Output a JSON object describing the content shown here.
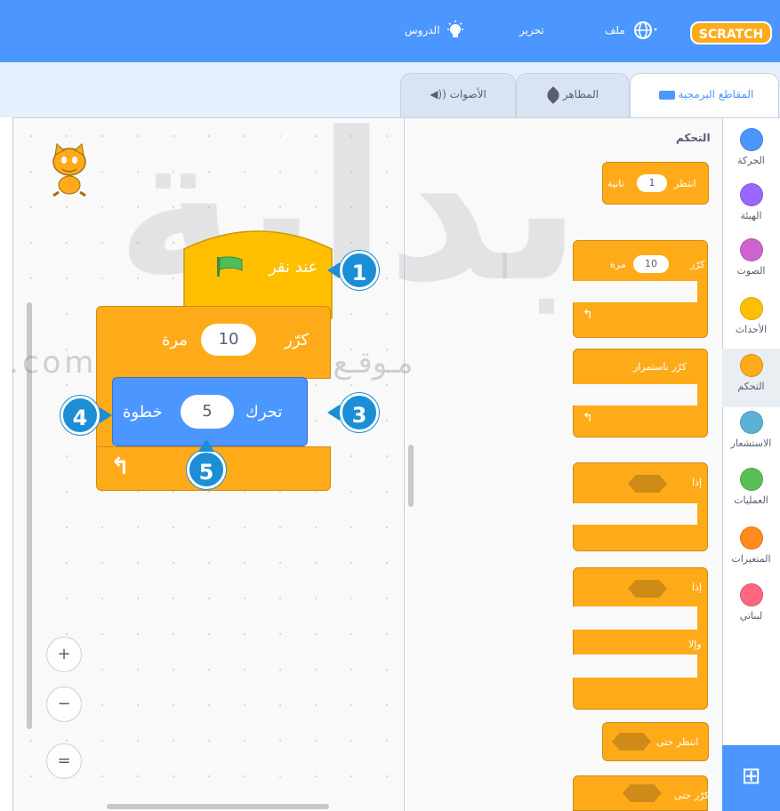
{
  "topbar": {
    "logo": "SCRATCH",
    "file": "ملف",
    "edit": "تحرير",
    "tutorials": "الدروس",
    "globe_caret": "▾"
  },
  "tabs": [
    {
      "label": "المقاطع البرمجية"
    },
    {
      "label": "المظاهر"
    },
    {
      "label": "الأصوات"
    }
  ],
  "categories": [
    {
      "label": "الحركة",
      "color": "#4c97ff"
    },
    {
      "label": "الهيئة",
      "color": "#9966ff"
    },
    {
      "label": "الصوت",
      "color": "#cf63cf"
    },
    {
      "label": "الأحداث",
      "color": "#ffbf00"
    },
    {
      "label": "التحكم",
      "color": "#ffab19"
    },
    {
      "label": "الاستشعار",
      "color": "#5cb1d6"
    },
    {
      "label": "العمليات",
      "color": "#59c059"
    },
    {
      "label": "المتغيرات",
      "color": "#ff8c1a"
    },
    {
      "label": "لبناتي",
      "color": "#ff6680"
    }
  ],
  "palette": {
    "heading": "التحكم",
    "wait": {
      "label": "انتظر",
      "value": "1",
      "unit": "ثانية"
    },
    "repeat": {
      "label": "كرّر",
      "value": "10",
      "unit": "مرة"
    },
    "forever": "كرّر باستمرار",
    "if1": "إذا",
    "if2": "إذا",
    "else": "وإلا",
    "wait_until": "انتظر حتى",
    "repeat_until": "كرّر حتى"
  },
  "script": {
    "hat": "عند نقر",
    "repeat_label": "كرّر",
    "repeat_value": "10",
    "repeat_unit": "مرة",
    "move_label": "تحرك",
    "move_value": "5",
    "move_unit": "خطوة"
  },
  "badges": [
    "1",
    "3",
    "4",
    "5"
  ],
  "zoom": {
    "in": "+",
    "out": "−",
    "reset": "="
  },
  "watermark": {
    "text": "مـوقـع بـدايــة التعليمي | com.",
    "brand": "بداية"
  },
  "colors": {
    "accent": "#4c97ff",
    "control": "#ffab19",
    "events": "#ffbf00",
    "badge": "#1c8ed6"
  }
}
